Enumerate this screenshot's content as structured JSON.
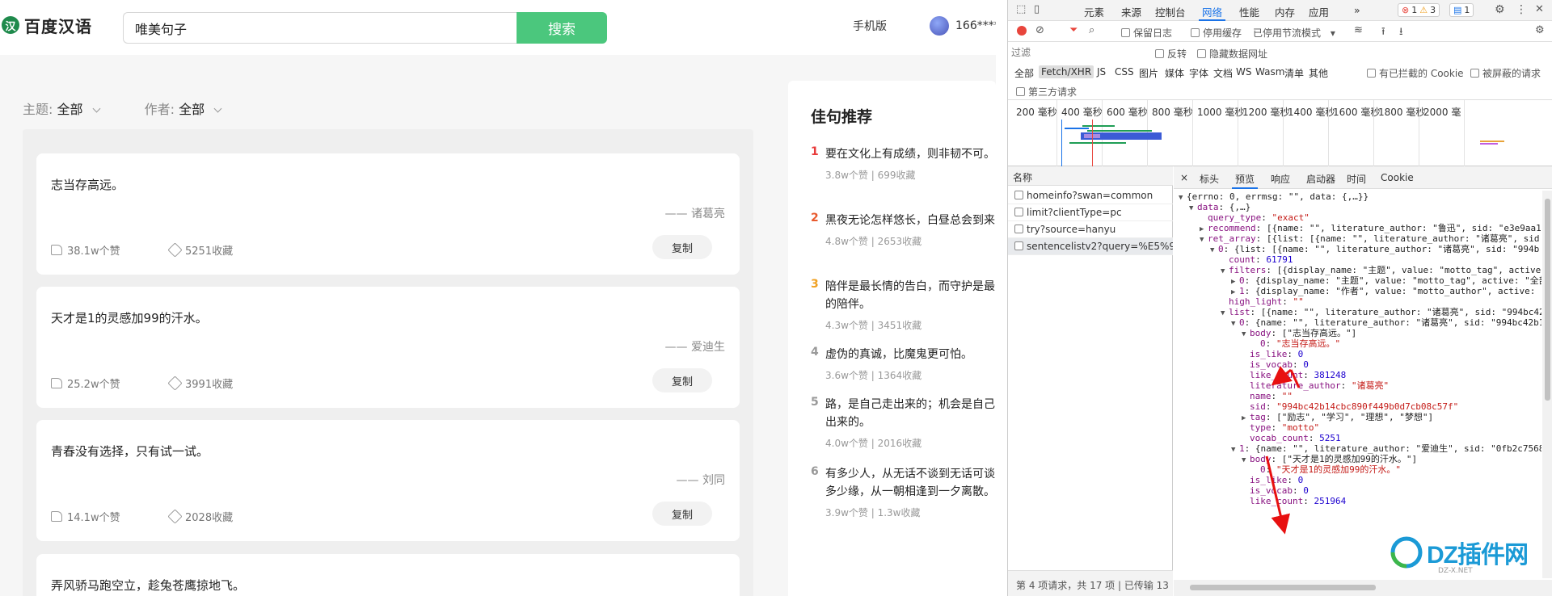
{
  "web": {
    "logo_text": "百度汉语",
    "search_value": "唯美句子",
    "search_button": "搜索",
    "mobile_link": "手机版",
    "user_name": "166*****",
    "filters": [
      {
        "key": "主题:",
        "value": "全部"
      },
      {
        "key": "作者:",
        "value": "全部"
      }
    ],
    "cards": [
      {
        "text": "志当存高远。",
        "author": "—— 诸葛亮",
        "likes": "38.1w个赞",
        "favs": "5251收藏",
        "copy": "复制"
      },
      {
        "text": "天才是1的灵感加99的汗水。",
        "author": "—— 爱迪生",
        "likes": "25.2w个赞",
        "favs": "3991收藏",
        "copy": "复制"
      },
      {
        "text": "青春没有选择，只有试一试。",
        "author": "—— 刘同",
        "likes": "14.1w个赞",
        "favs": "2028收藏",
        "copy": "复制"
      },
      {
        "text": "弄风骄马跑空立，趁兔苍鹰掠地飞。",
        "author": "",
        "likes": "",
        "favs": "",
        "copy": ""
      }
    ],
    "recommend": {
      "title": "佳句推荐",
      "items": [
        {
          "num": "1",
          "line1": "要在文化上有成绩，则非韧不可。",
          "line2": "",
          "meta": "3.8w个赞  |  699收藏",
          "color": "#e83a3a"
        },
        {
          "num": "2",
          "line1": "黑夜无论怎样悠长，白昼总会到来",
          "line2": "",
          "meta": "4.8w个赞  |  2653收藏",
          "color": "#e85a2e"
        },
        {
          "num": "3",
          "line1": "陪伴是最长情的告白，而守护是最",
          "line2": "的陪伴。",
          "meta": "4.3w个赞  |  3451收藏",
          "color": "#f0a020"
        },
        {
          "num": "4",
          "line1": "虚伪的真诚，比魔鬼更可怕。",
          "line2": "",
          "meta": "3.6w个赞  |  1364收藏",
          "color": "#999999"
        },
        {
          "num": "5",
          "line1": "路，是自己走出来的；机会是自己",
          "line2": "出来的。",
          "meta": "4.0w个赞  |  2016收藏",
          "color": "#999999"
        },
        {
          "num": "6",
          "line1": "有多少人，从无话不谈到无话可谈",
          "line2": "多少缘，从一朝相逢到一夕离散。",
          "meta": "3.9w个赞  |  1.3w收藏",
          "color": "#999999"
        }
      ]
    }
  },
  "devtools": {
    "tabs": [
      "元素",
      "来源",
      "控制台",
      "网络",
      "性能",
      "内存",
      "应用"
    ],
    "more": "»",
    "badges": {
      "errors": "1",
      "warnings": "3",
      "messages": "1"
    },
    "toolbar": {
      "preserve_log": "保留日志",
      "disable_cache": "停用缓存",
      "throttle": "已停用节流模式"
    },
    "filter": {
      "placeholder": "过滤",
      "invert": "反转",
      "hide_data": "隐藏数据网址"
    },
    "types": [
      "全部",
      "Fetch/XHR",
      "JS",
      "CSS",
      "图片",
      "媒体",
      "字体",
      "文档",
      "WS",
      "Wasm",
      "清单",
      "其他"
    ],
    "blocked_cookies": "有已拦截的 Cookie",
    "blocked_requests": "被屏蔽的请求",
    "third_party": "第三方请求",
    "timeline_labels": [
      "200 毫秒",
      "400 毫秒",
      "600 毫秒",
      "800 毫秒",
      "1000 毫秒",
      "1200 毫秒",
      "1400 毫秒",
      "1600 毫秒",
      "1800 毫秒",
      "2000 毫"
    ],
    "names_header": "名称",
    "requests": [
      "homeinfo?swan=common",
      "limit?clientType=pc",
      "try?source=hanyu",
      "sentencelistv2?query=%E5%9..."
    ],
    "status": "第 4 项请求，共 17 项  |  已传输 13",
    "preview_tabs": [
      "×",
      "标头",
      "预览",
      "响应",
      "启动器",
      "时间",
      "Cookie"
    ]
  },
  "json_lines": [
    {
      "indent": 0,
      "tri": "▼",
      "parts": [
        [
          "p",
          "{errno: 0, errmsg: \"\", data: {,…}}"
        ]
      ]
    },
    {
      "indent": 1,
      "tri": "▼",
      "parts": [
        [
          "k",
          "data"
        ],
        [
          "p",
          ": {,…}"
        ]
      ]
    },
    {
      "indent": 2,
      "tri": "",
      "parts": [
        [
          "k",
          "query_type"
        ],
        [
          "p",
          ": "
        ],
        [
          "s",
          "\"exact\""
        ]
      ]
    },
    {
      "indent": 2,
      "tri": "▶",
      "parts": [
        [
          "k",
          "recommend"
        ],
        [
          "p",
          ": [{name: \"\", literature_author: \"鲁迅\", sid: \"e3e9aa1"
        ]
      ]
    },
    {
      "indent": 2,
      "tri": "▼",
      "parts": [
        [
          "k",
          "ret_array"
        ],
        [
          "p",
          ": [{list: [{name: \"\", literature_author: \"诸葛亮\", sid"
        ]
      ]
    },
    {
      "indent": 3,
      "tri": "▼",
      "parts": [
        [
          "k",
          "0"
        ],
        [
          "p",
          ": {list: [{name: \"\", literature_author: \"诸葛亮\", sid: \"994b"
        ]
      ]
    },
    {
      "indent": 4,
      "tri": "",
      "parts": [
        [
          "k",
          "count"
        ],
        [
          "p",
          ": "
        ],
        [
          "n",
          "61791"
        ]
      ]
    },
    {
      "indent": 4,
      "tri": "▼",
      "parts": [
        [
          "k",
          "filters"
        ],
        [
          "p",
          ": [{display_name: \"主题\", value: \"motto_tag\", active"
        ]
      ]
    },
    {
      "indent": 5,
      "tri": "▶",
      "parts": [
        [
          "k",
          "0"
        ],
        [
          "p",
          ": {display_name: \"主题\", value: \"motto_tag\", active: \"全部"
        ]
      ]
    },
    {
      "indent": 5,
      "tri": "▶",
      "parts": [
        [
          "k",
          "1"
        ],
        [
          "p",
          ": {display_name: \"作者\", value: \"motto_author\", active: \""
        ]
      ]
    },
    {
      "indent": 4,
      "tri": "",
      "parts": [
        [
          "k",
          "high_light"
        ],
        [
          "p",
          ": "
        ],
        [
          "s",
          "\"\""
        ]
      ]
    },
    {
      "indent": 4,
      "tri": "▼",
      "parts": [
        [
          "k",
          "list"
        ],
        [
          "p",
          ": [{name: \"\", literature_author: \"诸葛亮\", sid: \"994bc42"
        ]
      ]
    },
    {
      "indent": 5,
      "tri": "▼",
      "parts": [
        [
          "k",
          "0"
        ],
        [
          "p",
          ": {name: \"\", literature_author: \"诸葛亮\", sid: \"994bc42b1"
        ]
      ]
    },
    {
      "indent": 6,
      "tri": "▼",
      "parts": [
        [
          "k",
          "body"
        ],
        [
          "p",
          ": [\"志当存高远。\"]"
        ]
      ]
    },
    {
      "indent": 7,
      "tri": "",
      "parts": [
        [
          "k",
          "0"
        ],
        [
          "p",
          ": "
        ],
        [
          "s",
          "\"志当存高远。\""
        ]
      ]
    },
    {
      "indent": 6,
      "tri": "",
      "parts": [
        [
          "k",
          "is_like"
        ],
        [
          "p",
          ": "
        ],
        [
          "n",
          "0"
        ]
      ]
    },
    {
      "indent": 6,
      "tri": "",
      "parts": [
        [
          "k",
          "is_vocab"
        ],
        [
          "p",
          ": "
        ],
        [
          "n",
          "0"
        ]
      ]
    },
    {
      "indent": 6,
      "tri": "",
      "parts": [
        [
          "k",
          "like_count"
        ],
        [
          "p",
          ": "
        ],
        [
          "n",
          "381248"
        ]
      ]
    },
    {
      "indent": 6,
      "tri": "",
      "parts": [
        [
          "k",
          "literature_author"
        ],
        [
          "p",
          ": "
        ],
        [
          "s",
          "\"诸葛亮\""
        ]
      ]
    },
    {
      "indent": 6,
      "tri": "",
      "parts": [
        [
          "k",
          "name"
        ],
        [
          "p",
          ": "
        ],
        [
          "s",
          "\"\""
        ]
      ]
    },
    {
      "indent": 6,
      "tri": "",
      "parts": [
        [
          "k",
          "sid"
        ],
        [
          "p",
          ": "
        ],
        [
          "s",
          "\"994bc42b14cbc890f449b0d7cb08c57f\""
        ]
      ]
    },
    {
      "indent": 6,
      "tri": "▶",
      "parts": [
        [
          "k",
          "tag"
        ],
        [
          "p",
          ": [\"励志\", \"学习\", \"理想\", \"梦想\"]"
        ]
      ]
    },
    {
      "indent": 6,
      "tri": "",
      "parts": [
        [
          "k",
          "type"
        ],
        [
          "p",
          ": "
        ],
        [
          "s",
          "\"motto\""
        ]
      ]
    },
    {
      "indent": 6,
      "tri": "",
      "parts": [
        [
          "k",
          "vocab_count"
        ],
        [
          "p",
          ": "
        ],
        [
          "n",
          "5251"
        ]
      ]
    },
    {
      "indent": 5,
      "tri": "▼",
      "parts": [
        [
          "k",
          "1"
        ],
        [
          "p",
          ": {name: \"\", literature_author: \"爱迪生\", sid: \"0fb2c7568"
        ]
      ]
    },
    {
      "indent": 6,
      "tri": "▼",
      "parts": [
        [
          "k",
          "body"
        ],
        [
          "p",
          ": [\"天才是1的灵感加99的汗水。\"]"
        ]
      ]
    },
    {
      "indent": 7,
      "tri": "",
      "parts": [
        [
          "k",
          "0"
        ],
        [
          "p",
          ": "
        ],
        [
          "s",
          "\"天才是1的灵感加99的汗水。\""
        ]
      ]
    },
    {
      "indent": 6,
      "tri": "",
      "parts": [
        [
          "k",
          "is_like"
        ],
        [
          "p",
          ": "
        ],
        [
          "n",
          "0"
        ]
      ]
    },
    {
      "indent": 6,
      "tri": "",
      "parts": [
        [
          "k",
          "is_vocab"
        ],
        [
          "p",
          ": "
        ],
        [
          "n",
          "0"
        ]
      ]
    },
    {
      "indent": 6,
      "tri": "",
      "parts": [
        [
          "k",
          "like_count"
        ],
        [
          "p",
          ": "
        ],
        [
          "n",
          "251964"
        ]
      ]
    }
  ],
  "watermark": {
    "text": "DZ插件网",
    "sub": "DZ-X.NET"
  }
}
